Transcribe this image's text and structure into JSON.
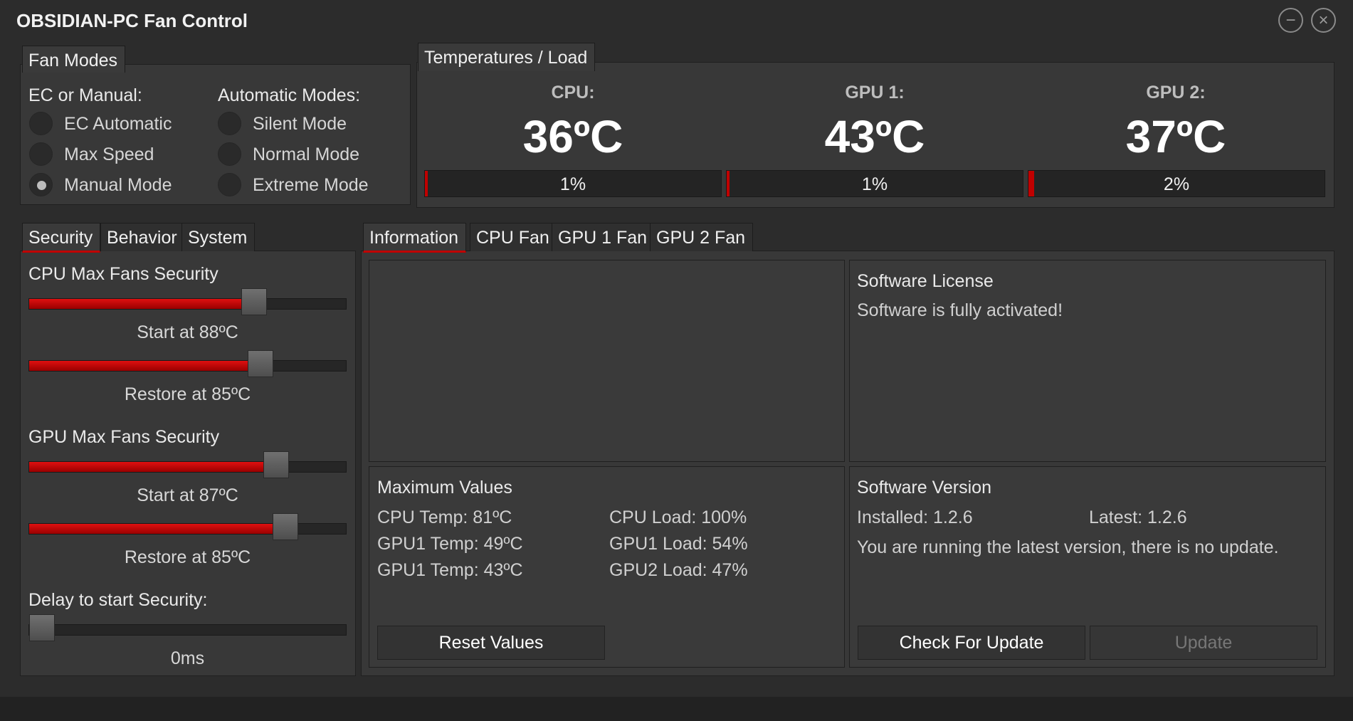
{
  "window": {
    "title": "OBSIDIAN-PC Fan Control",
    "minimize_icon": "minus-circle-icon",
    "close_icon": "x-circle-icon"
  },
  "fan_modes": {
    "tab_label": "Fan Modes",
    "ec_header": "EC or Manual:",
    "auto_header": "Automatic Modes:",
    "ec_options": [
      {
        "label": "EC Automatic",
        "selected": false
      },
      {
        "label": "Max Speed",
        "selected": false
      },
      {
        "label": "Manual Mode",
        "selected": true
      }
    ],
    "auto_options": [
      {
        "label": "Silent Mode",
        "selected": false
      },
      {
        "label": "Normal Mode",
        "selected": false
      },
      {
        "label": "Extreme Mode",
        "selected": false
      }
    ]
  },
  "temps": {
    "tab_label": "Temperatures / Load",
    "items": [
      {
        "name": "CPU:",
        "temp": "36ºC",
        "load": "1%",
        "load_value": 1
      },
      {
        "name": "GPU 1:",
        "temp": "43ºC",
        "load": "1%",
        "load_value": 1
      },
      {
        "name": "GPU 2:",
        "temp": "37ºC",
        "load": "2%",
        "load_value": 2
      }
    ]
  },
  "left_tabs": [
    "Security",
    "Behavior",
    "System"
  ],
  "security": {
    "cpu_title": "CPU Max Fans Security",
    "cpu_start": {
      "label": "Start at 88ºC",
      "value": 0.71
    },
    "cpu_restore": {
      "label": "Restore at 85ºC",
      "value": 0.73
    },
    "gpu_title": "GPU Max Fans Security",
    "gpu_start": {
      "label": "Start at 87ºC",
      "value": 0.78
    },
    "gpu_restore": {
      "label": "Restore at 85ºC",
      "value": 0.81
    },
    "delay_title": "Delay to start Security:",
    "delay": {
      "label": "0ms",
      "value": 0.0
    }
  },
  "right_tabs": [
    "Information",
    "CPU Fan",
    "GPU 1 Fan",
    "GPU 2 Fan"
  ],
  "info": {
    "license_title": "Software License",
    "license_text": "Software is fully activated!",
    "max_title": "Maximum Values",
    "max_left": [
      "CPU Temp: 81ºC",
      "GPU1 Temp: 49ºC",
      "GPU1 Temp: 43ºC"
    ],
    "max_right": [
      "CPU Load: 100%",
      "GPU1 Load: 54%",
      "GPU2 Load: 47%"
    ],
    "reset_label": "Reset Values",
    "version_title": "Software Version",
    "installed": "Installed: 1.2.6",
    "latest": "Latest: 1.2.6",
    "version_msg": "You are running the latest version, there is no update.",
    "check_label": "Check For Update",
    "update_label": "Update"
  },
  "colors": {
    "accent": "#c00000",
    "background": "#2c2c2c",
    "panel": "#383838"
  }
}
